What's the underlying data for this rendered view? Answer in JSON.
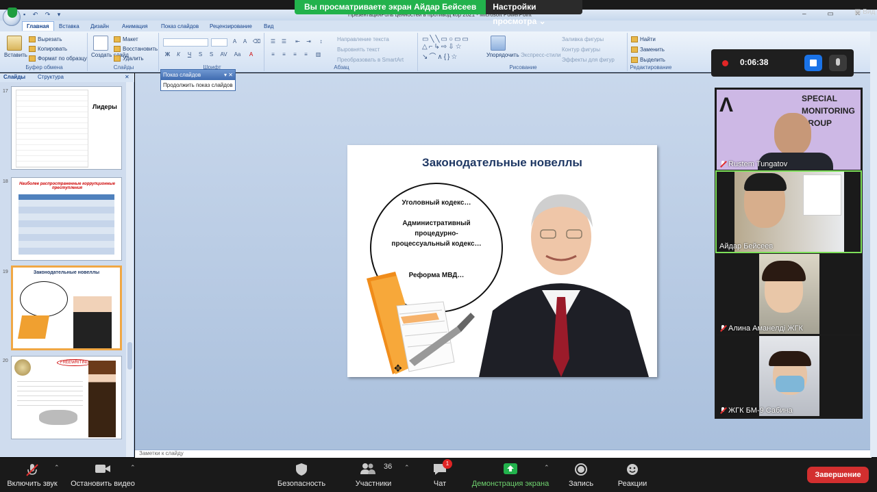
{
  "zoom": {
    "share_banner": "Вы просматриваете экран Айдар Бейсеев",
    "view_options": "Настройки просмотра",
    "view_label": "Вид",
    "recording_time": "0:06:38",
    "toolbar": {
      "mute": "Включить звук",
      "video": "Остановить видео",
      "security": "Безопасность",
      "participants": "Участники",
      "participants_count": "36",
      "chat": "Чат",
      "chat_badge": "1",
      "share": "Демонстрация экрана",
      "record": "Запись",
      "reactions": "Реакции",
      "end": "Завершение"
    },
    "participants": [
      {
        "name": "Rustem Tungatov",
        "bg_text_1": "SPECIAL",
        "bg_text_2": "MONITORING",
        "bg_text_3": "GROUP",
        "logo": "Λ",
        "muted": true
      },
      {
        "name": "Айдар Бейсеев",
        "muted": false
      },
      {
        "name": "Алина Аманелді ЖГК",
        "muted": true
      },
      {
        "name": "ЖГК БМ-9 Сабина",
        "muted": true
      }
    ]
  },
  "ppt": {
    "window_title": "ПрезентацияРоль ценностей в противод кор 2021 - Microsoft PowerPoint",
    "tabs": [
      "Главная",
      "Вставка",
      "Дизайн",
      "Анимация",
      "Показ слайдов",
      "Рецензирование",
      "Вид"
    ],
    "clipboard": {
      "paste": "Вставить",
      "cut": "Вырезать",
      "copy": "Копировать",
      "format": "Формат по образцу",
      "caption": "Буфер обмена"
    },
    "slides_group": {
      "create": "Создать слайд",
      "layout": "Макет",
      "reset": "Восстановить",
      "delete": "Удалить",
      "caption": "Слайды"
    },
    "font_caption": "Шрифт",
    "paragraph": {
      "direction": "Направление текста",
      "align": "Выровнять текст",
      "smartart": "Преобразовать в SmartArt",
      "caption": "Абзац"
    },
    "drawing": {
      "arrange": "Упорядочить",
      "styles": "Экспресс-стили",
      "fill": "Заливка фигуры",
      "outline": "Контур фигуры",
      "effects": "Эффекты для фигур",
      "caption": "Рисование"
    },
    "editing": {
      "find": "Найти",
      "replace": "Заменить",
      "select": "Выделить",
      "caption": "Редактирование"
    },
    "panel_tabs": {
      "slides": "Слайды",
      "outline": "Структура"
    },
    "popup": {
      "title": "Показ слайдов",
      "item": "Продолжить показ слайдов"
    },
    "notes_placeholder": "Заметки к слайду",
    "thumbnails": [
      {
        "num": "17",
        "title": "Лидеры"
      },
      {
        "num": "18",
        "title": "Наиболее распространенные коррупционные преступления"
      },
      {
        "num": "19",
        "title": "Законодательные новеллы"
      },
      {
        "num": "20",
        "title": "FREEWRITING"
      }
    ],
    "slide": {
      "title": "Законодательные новеллы",
      "line1": "Уголовный кодекс…",
      "line2": "Административный процедурно-процессуальный кодекс…",
      "line3": "Реформа МВД…"
    }
  }
}
